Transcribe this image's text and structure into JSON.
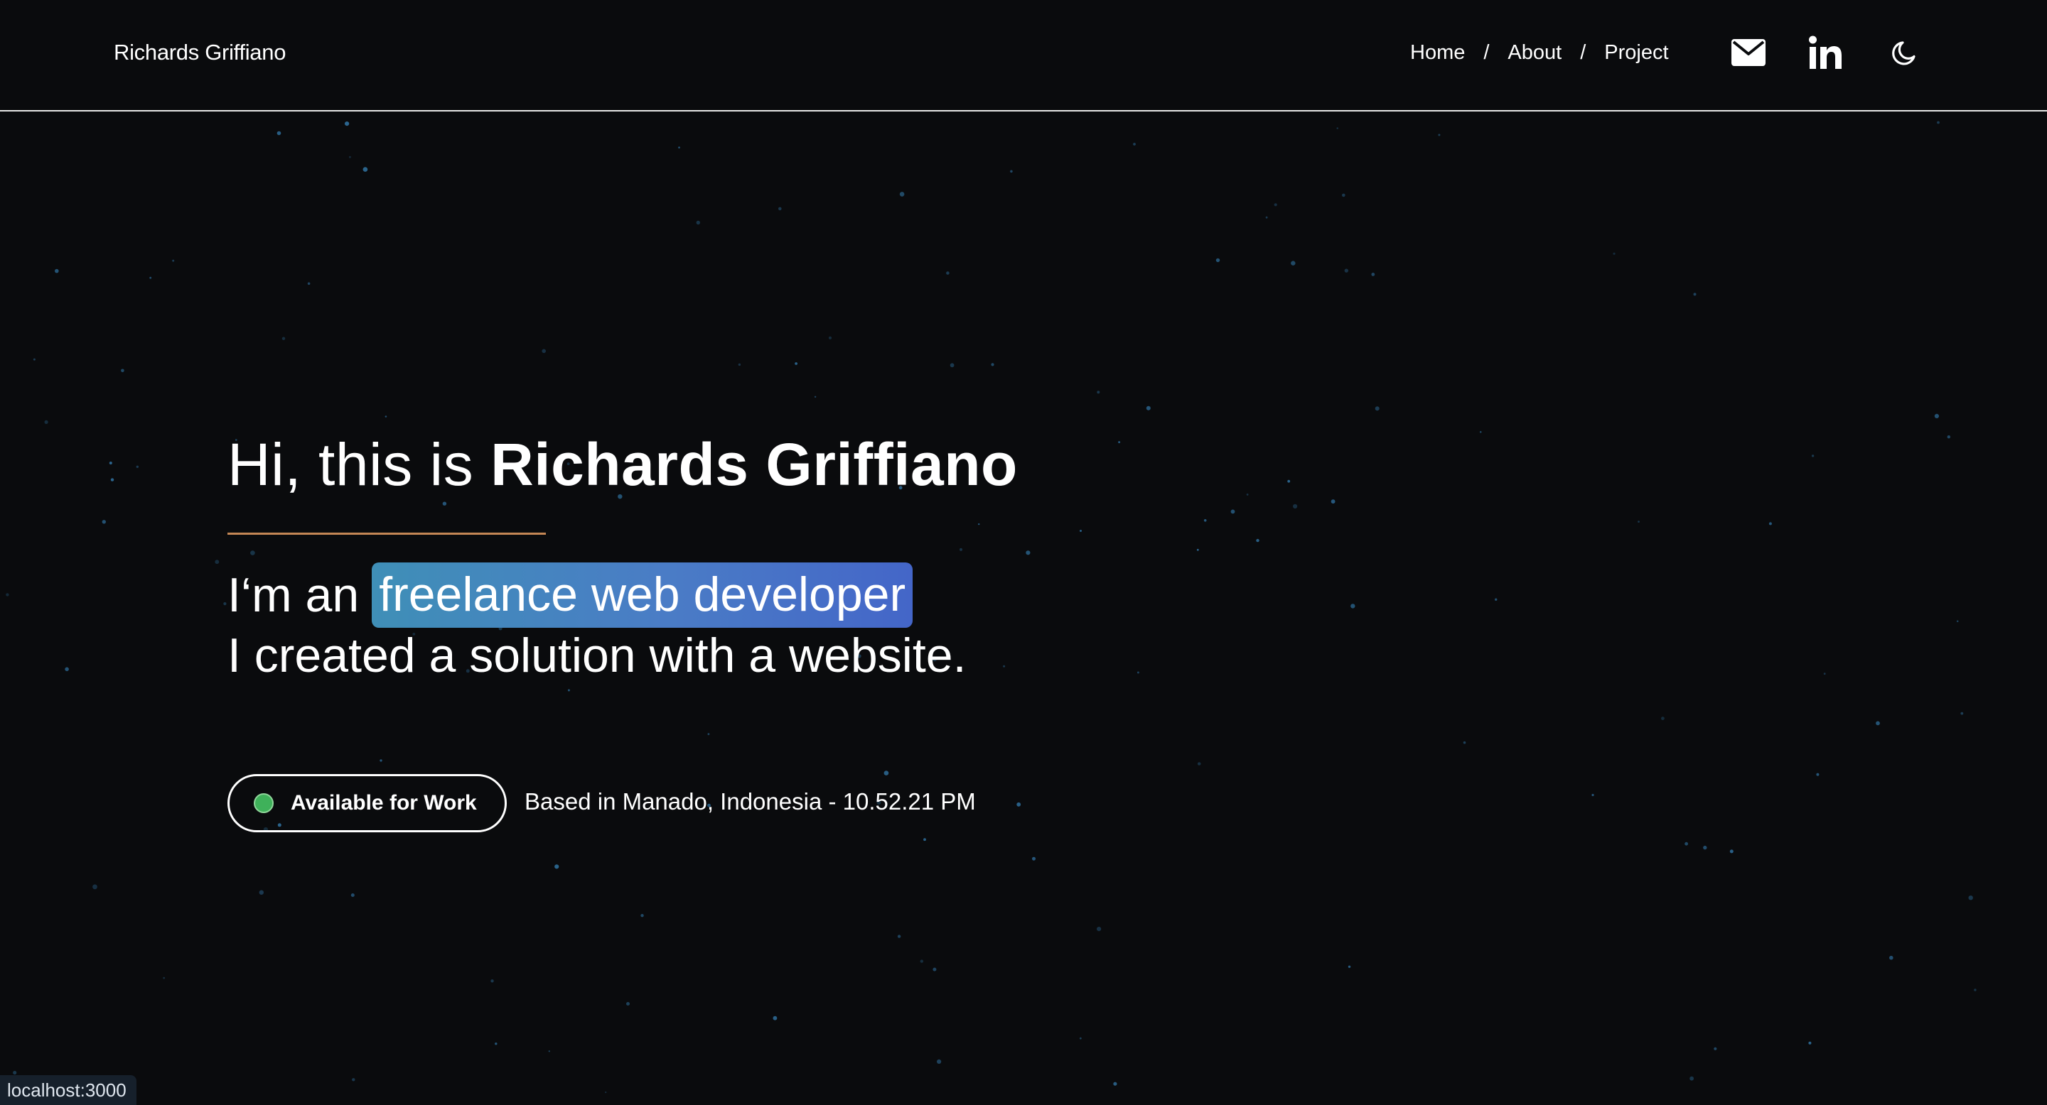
{
  "header": {
    "brand": "Richards Griffiano",
    "nav": [
      {
        "label": "Home"
      },
      {
        "label": "About"
      },
      {
        "label": "Project"
      }
    ],
    "separator": "/",
    "icons": [
      "mail-icon",
      "linkedin-icon",
      "moon-icon"
    ]
  },
  "hero": {
    "greeting_prefix": "Hi, this is ",
    "name": "Richards Griffiano",
    "role_prefix": "I‘m an",
    "role_highlight": "freelance web developer",
    "tagline": "I created a solution with a website.",
    "status_label": "Available for Work",
    "location": "Based in Manado, Indonesia - 10.52.21 PM"
  },
  "browser_status": {
    "url": "localhost:3000"
  },
  "colors": {
    "background": "#0a0b0d",
    "divider": "#c48755",
    "highlight_start": "#3f8fb7",
    "highlight_end": "#4466c8",
    "status_green": "#3fb15a",
    "star": "#2f6f9c"
  }
}
